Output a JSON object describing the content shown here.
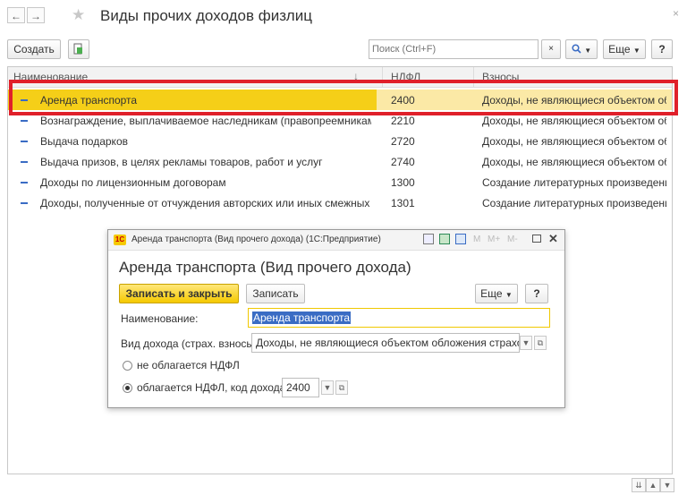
{
  "window": {
    "title": "Виды прочих доходов физлиц",
    "close_glyph": "×"
  },
  "toolbar": {
    "create_label": "Создать",
    "search_placeholder": "Поиск (Ctrl+F)",
    "more_label": "Еще",
    "help_label": "?"
  },
  "table": {
    "headers": [
      "Наименование",
      "НДФЛ",
      "Взносы"
    ],
    "rows": [
      {
        "name": "Аренда транспорта",
        "ndfl": "2400",
        "vznosy": "Доходы, не являющиеся объектом обл...",
        "selected": true
      },
      {
        "name": "Вознаграждение, выплачиваемое наследникам (правопреемникам) авт...",
        "ndfl": "2210",
        "vznosy": "Доходы, не являющиеся объектом обл..."
      },
      {
        "name": "Выдача подарков",
        "ndfl": "2720",
        "vznosy": "Доходы, не являющиеся объектом обл..."
      },
      {
        "name": "Выдача призов, в целях рекламы товаров, работ и услуг",
        "ndfl": "2740",
        "vznosy": "Доходы, не являющиеся объектом обл..."
      },
      {
        "name": "Доходы по лицензионным договорам",
        "ndfl": "1300",
        "vznosy": "Создание литературных произведений,..."
      },
      {
        "name": "Доходы, полученные от отчуждения авторских или иных смежных прав",
        "ndfl": "1301",
        "vznosy": "Создание литературных произведений,..."
      }
    ]
  },
  "dialog": {
    "window_title": "Аренда транспорта (Вид прочего дохода)  (1С:Предприятие)",
    "logo_text": "1С",
    "header": "Аренда транспорта (Вид прочего дохода)",
    "save_close_label": "Записать и закрыть",
    "save_label": "Записать",
    "more_label": "Еще",
    "help_label": "?",
    "name_label": "Наименование:",
    "name_value": "Аренда транспорта",
    "income_type_label": "Вид дохода (страх. взносы):",
    "income_type_value": "Доходы, не являющиеся объектом обложения страховыми в",
    "radio_not_taxed": "не облагается НДФЛ",
    "radio_taxed": "облагается НДФЛ, код дохода:",
    "code_value": "2400",
    "title_tools": [
      "M",
      "M+",
      "M-"
    ]
  },
  "colors": {
    "highlight": "#e0202a",
    "selected_row": "#fbe9a6",
    "accent_yellow": "#f5c900"
  }
}
